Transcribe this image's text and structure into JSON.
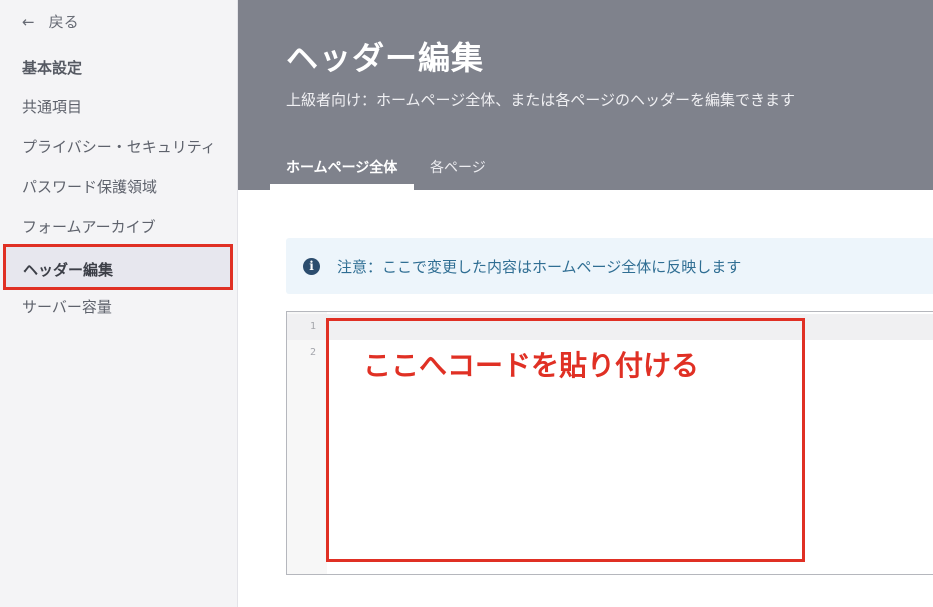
{
  "sidebar": {
    "back_arrow": "←",
    "back_label": "戻る",
    "section_title": "基本設定",
    "items": [
      {
        "label": "共通項目"
      },
      {
        "label": "プライバシー・セキュリティ"
      },
      {
        "label": "パスワード保護領域"
      },
      {
        "label": "フォームアーカイブ"
      },
      {
        "label": "ヘッダー編集"
      },
      {
        "label": "サーバー容量"
      }
    ]
  },
  "header": {
    "title": "ヘッダー編集",
    "subtitle": "上級者向け：ホームページ全体、または各ページのヘッダーを編集できます",
    "tabs": [
      {
        "label": "ホームページ全体"
      },
      {
        "label": "各ページ"
      }
    ]
  },
  "notice": {
    "icon": "info-icon",
    "icon_glyph": "i",
    "text": "注意：ここで変更した内容はホームページ全体に反映します"
  },
  "editor": {
    "line_numbers": [
      "1",
      "2"
    ]
  },
  "annotation": {
    "text": "ここへコードを貼り付ける",
    "color": "#e03024"
  },
  "colors": {
    "header_bg": "#7f828c",
    "sidebar_bg": "#f4f4f6",
    "notice_bg": "#edf5fb",
    "notice_text": "#2f6e93",
    "highlight": "#e03024"
  }
}
